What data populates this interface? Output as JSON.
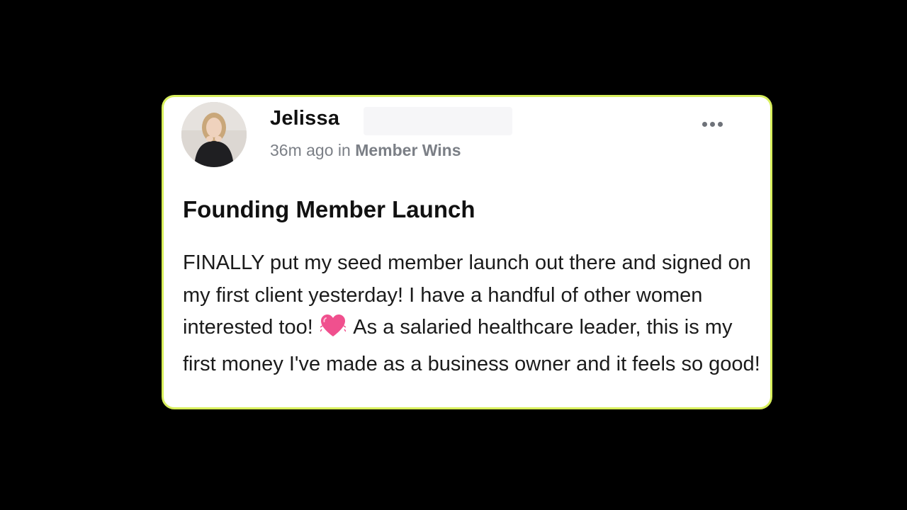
{
  "post": {
    "author_name": "Jelissa",
    "time_ago": "36m ago",
    "meta_connector": "in",
    "category": "Member Wins",
    "title": "Founding Member Launch",
    "body_before_emoji": "FINALLY put my seed member launch out there and signed on my first client yesterday! I have a handful of other women interested too! ",
    "emoji": "heart-icon",
    "body_after_emoji": " As a salaried healthcare leader, this is my first money I've made as a business owner and it feels so good!"
  },
  "colors": {
    "card_border": "#d8ef5c",
    "background": "#000000",
    "heart": "#f0508e"
  }
}
